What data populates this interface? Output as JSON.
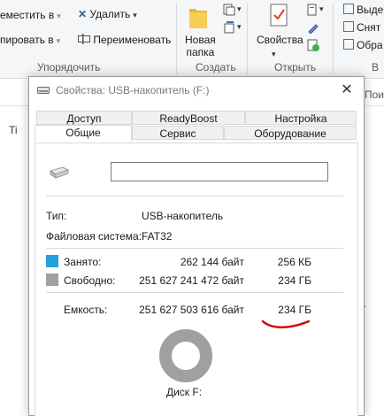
{
  "ribbon": {
    "move_to": "еместить в",
    "copy_to": "пировать в",
    "delete": "Удалить",
    "rename": "Переименовать",
    "new_folder_line1": "Новая",
    "new_folder_line2": "папка",
    "properties": "Свойства",
    "select_all": "Выде",
    "select_none": "Снят",
    "invert": "Обра",
    "group_organize": "Упорядочить",
    "group_create": "Создать",
    "group_open": "Открыть",
    "group_select": "В",
    "search_hint": "Пои",
    "left_cut": "Ti",
    "right_dot": "a."
  },
  "dialog": {
    "title": "Свойства: USB-накопитель (F:)",
    "tabs_row1": [
      "Доступ",
      "ReadyBoost",
      "Настройка"
    ],
    "tabs_row2": [
      "Общие",
      "Сервис",
      "Оборудование"
    ],
    "active_tab": "Общие",
    "name_value": "",
    "type_label": "Тип:",
    "type_value": "USB-накопитель",
    "fs_label": "Файловая система:",
    "fs_value": "FAT32",
    "used_label": "Занято:",
    "used_bytes": "262 144 байт",
    "used_human": "256 КБ",
    "free_label": "Свободно:",
    "free_bytes": "251 627 241 472 байт",
    "free_human": "234 ГБ",
    "capacity_label": "Емкость:",
    "capacity_bytes": "251 627 503 616 байт",
    "capacity_human": "234 ГБ",
    "disk_label": "Диск F:",
    "used_fraction": 1e-06
  },
  "colors": {
    "used": "#26a0da",
    "free": "#a0a0a0",
    "annotation": "#d40000"
  },
  "icons": {
    "delete": "x-icon",
    "rename": "rename-icon",
    "new_folder": "folder-icon",
    "properties": "checklist-icon",
    "drive": "usb-drive-icon",
    "close": "close-icon"
  }
}
